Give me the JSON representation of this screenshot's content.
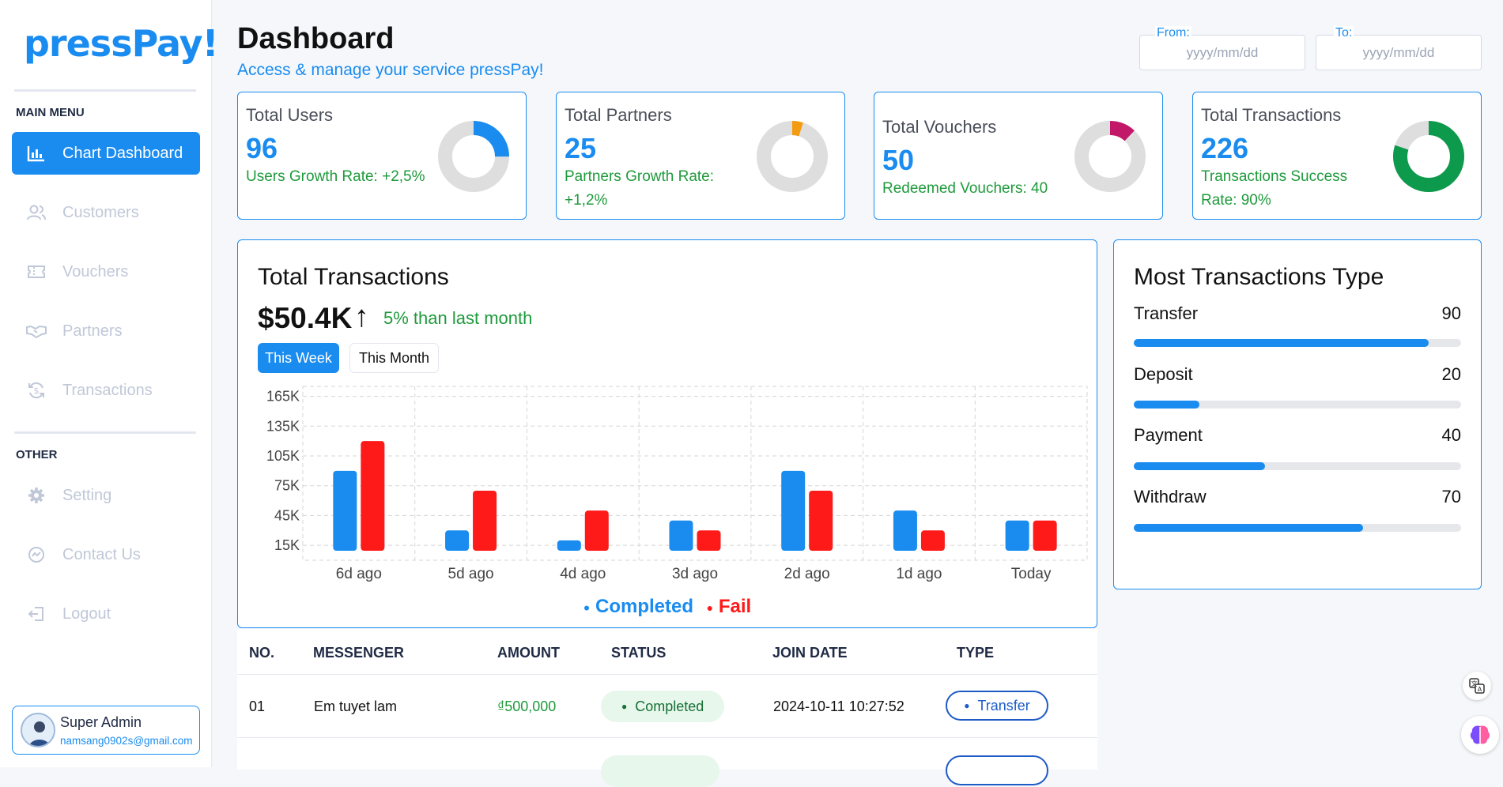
{
  "app": {
    "logo": "pressPay!"
  },
  "sidebar": {
    "main_menu_heading": "MAIN MENU",
    "other_heading": "OTHER",
    "items": [
      {
        "label": "Chart Dashboard",
        "icon": "bar-chart-icon",
        "active": true
      },
      {
        "label": "Customers",
        "icon": "users-icon"
      },
      {
        "label": "Vouchers",
        "icon": "ticket-icon"
      },
      {
        "label": "Partners",
        "icon": "handshake-icon"
      },
      {
        "label": "Transactions",
        "icon": "refresh-dollar-icon"
      }
    ],
    "other_items": [
      {
        "label": "Setting",
        "icon": "gear-icon"
      },
      {
        "label": "Contact Us",
        "icon": "chat-icon"
      },
      {
        "label": "Logout",
        "icon": "logout-icon"
      }
    ],
    "profile": {
      "name": "Super Admin",
      "email": "namsang0902s@gmail.com"
    }
  },
  "header": {
    "title": "Dashboard",
    "subtitle": "Access & manage your service pressPay!",
    "from_label": "From:",
    "from_placeholder": "yyyy/mm/dd",
    "to_label": "To:",
    "to_placeholder": "yyyy/mm/dd"
  },
  "stats": [
    {
      "label": "Total Users",
      "value": "96",
      "sub": "Users Growth Rate: +2,5%",
      "ring_fraction": 0.25,
      "ring_color": "#1a8cf0"
    },
    {
      "label": "Total Partners",
      "value": "25",
      "sub": "Partners Growth Rate: +1,2%",
      "ring_fraction": 0.05,
      "ring_color": "#f39c12"
    },
    {
      "label": "Total Vouchers",
      "value": "50",
      "sub": "Redeemed Vouchers: 40",
      "ring_fraction": 0.12,
      "ring_color": "#c2186a"
    },
    {
      "label": "Total Transactions",
      "value": "226",
      "sub": "Transactions Success Rate: 90%",
      "ring_fraction": 0.8,
      "ring_color": "#0e9a4c"
    }
  ],
  "transactions_panel": {
    "title": "Total Transactions",
    "amount": "$50.4K",
    "delta": "5% than last month",
    "tabs": [
      "This Week",
      "This Month"
    ],
    "legend_completed": "Completed",
    "legend_fail": "Fail"
  },
  "chart_data": {
    "type": "bar",
    "categories": [
      "6d ago",
      "5d ago",
      "4d ago",
      "3d ago",
      "2d ago",
      "1d ago",
      "Today"
    ],
    "y_ticks": [
      "165K",
      "135K",
      "105K",
      "75K",
      "45K",
      "15K"
    ],
    "y_tick_values": [
      165,
      135,
      105,
      75,
      45,
      15
    ],
    "ylim": [
      0,
      175
    ],
    "series": [
      {
        "name": "Completed",
        "color": "#1a8cf0",
        "values": [
          90,
          30,
          20,
          40,
          90,
          50,
          40
        ]
      },
      {
        "name": "Fail",
        "color": "#ff1a1a",
        "values": [
          120,
          70,
          50,
          30,
          70,
          30,
          40
        ]
      }
    ],
    "grid": true
  },
  "types_panel": {
    "title": "Most Transactions Type",
    "max": 100,
    "items": [
      {
        "label": "Transfer",
        "value": 90
      },
      {
        "label": "Deposit",
        "value": 20
      },
      {
        "label": "Payment",
        "value": 40
      },
      {
        "label": "Withdraw",
        "value": 70
      }
    ]
  },
  "table": {
    "headers": [
      "NO.",
      "MESSENGER",
      "AMOUNT",
      "STATUS",
      "JOIN DATE",
      "TYPE"
    ],
    "rows": [
      {
        "no": "01",
        "messenger": "Em tuyet lam",
        "amount": "₫500,000",
        "status": "Completed",
        "date": "2024-10-11 10:27:52",
        "type": "Transfer"
      }
    ]
  }
}
